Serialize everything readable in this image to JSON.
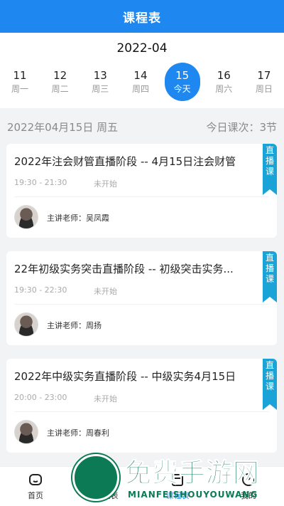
{
  "header": {
    "title": "课程表"
  },
  "calendar": {
    "month": "2022-04",
    "days": [
      {
        "num": "11",
        "weekday": "周一"
      },
      {
        "num": "12",
        "weekday": "周二"
      },
      {
        "num": "13",
        "weekday": "周三"
      },
      {
        "num": "14",
        "weekday": "周四"
      },
      {
        "num": "15",
        "weekday": "今天"
      },
      {
        "num": "16",
        "weekday": "周六"
      },
      {
        "num": "17",
        "weekday": "周日"
      }
    ]
  },
  "summary": {
    "date": "2022年04月15日 周五",
    "count": "今日课次：3节"
  },
  "courses": [
    {
      "title": "2022年注会财管直播阶段 -- 4月15日注会财管",
      "time": "19:30 - 21:30",
      "status": "未开始",
      "teacher": "主讲老师：吴凤霞",
      "tag": "直播课"
    },
    {
      "title": "22年初级实务突击直播阶段 -- 初级突击实务...",
      "time": "19:30 - 22:30",
      "status": "未开始",
      "teacher": "主讲老师：周扬",
      "tag": "直播课"
    },
    {
      "title": "2022年中级实务直播阶段 -- 中级实务4月15日",
      "time": "20:00 - 23:00",
      "status": "未开始",
      "teacher": "主讲老师：周春利",
      "tag": "直播课"
    }
  ],
  "tabbar": {
    "tabs": [
      {
        "label": "首页",
        "icon": "home-icon"
      },
      {
        "label": "课程表",
        "icon": "calendar-icon"
      },
      {
        "label": "课程表",
        "icon": "schedule-icon"
      },
      {
        "label": "我的",
        "icon": "user-icon"
      }
    ]
  },
  "watermark": {
    "text": "免费手游网",
    "sub": "MIANFEISHOUYOUWANG"
  },
  "colors": {
    "primary": "#1e87f0",
    "tag": "#1aa3d6",
    "watermark": "#0b7a55"
  }
}
